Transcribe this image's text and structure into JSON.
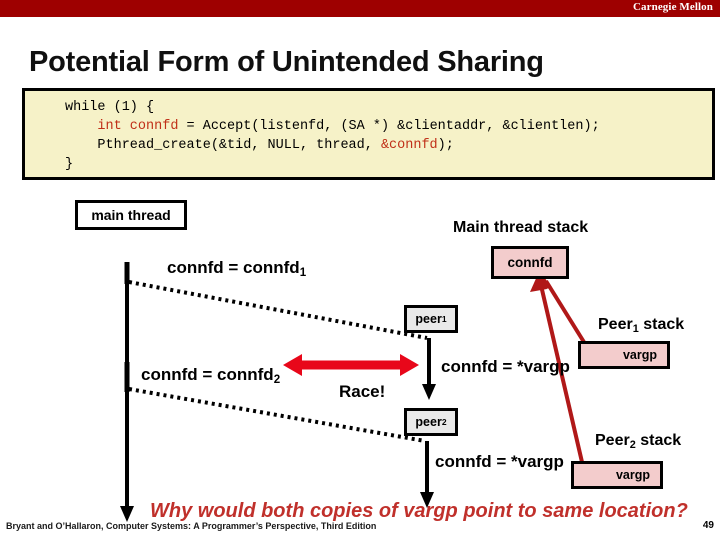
{
  "header": {
    "brand": "Carnegie Mellon",
    "bar_color": "#9E0000"
  },
  "title": "Potential Form of Unintended Sharing",
  "code": {
    "bg_color": "#F6F2C8",
    "keyword_color": "#C03018",
    "line1": "while (1) {",
    "line2_a": "    ",
    "line2_kw": "int connfd",
    "line2_b": " = Accept(listenfd, (SA *) &clientaddr, &clientlen);",
    "line3_a": "    Pthread_create(&tid, NULL, thread, ",
    "line3_kw": "&connfd",
    "line3_b": ");",
    "line4": "}"
  },
  "diagram": {
    "main_thread_label": "main thread",
    "main_stack_label": "Main thread stack",
    "connfd_box_label": "connfd",
    "peer1_label": "peer",
    "peer1_sub": "1",
    "peer2_label": "peer",
    "peer2_sub": "2",
    "peer1_stack_label": "Peer",
    "peer1_stack_sub": "1",
    "peer1_stack_tail": " stack",
    "peer2_stack_label": "Peer",
    "peer2_stack_sub": "2",
    "peer2_stack_tail": " stack",
    "vargp1_label": "vargp",
    "vargp2_label": "vargp",
    "connfd_assign_1": "connfd = connfd",
    "connfd_assign_1_sub": "1",
    "connfd_assign_2": "connfd = connfd",
    "connfd_assign_2_sub": "2",
    "connfd_vargp_1": "connfd = *vargp",
    "connfd_vargp_2": "connfd = *vargp",
    "race_label": "Race!",
    "race_arrow_color": "#E8071A",
    "pointer_color": "#B01818",
    "pink_box_color": "#F3CCCC",
    "gray_box_color": "#E9E9E9"
  },
  "question": "Why would both copies of vargp point to same location?",
  "question_color": "#C0302B",
  "footer": {
    "credit": "Bryant and O’Hallaron, Computer Systems: A Programmer’s Perspective, Third Edition",
    "page": "49"
  }
}
